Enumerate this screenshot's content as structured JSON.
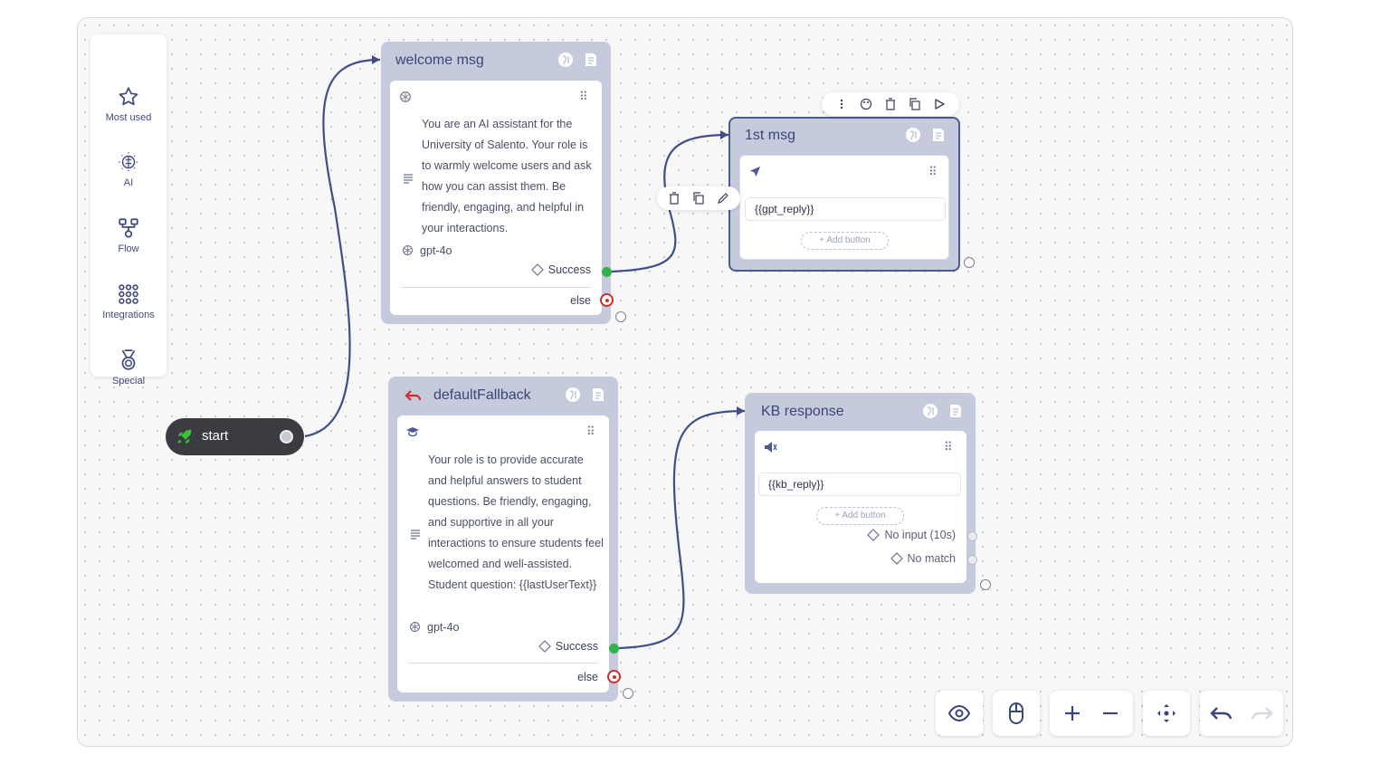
{
  "palette": {
    "items": [
      {
        "label": "Most used",
        "icon": "star-icon"
      },
      {
        "label": "AI",
        "icon": "brain-icon"
      },
      {
        "label": "Flow",
        "icon": "flow-icon"
      },
      {
        "label": "Integrations",
        "icon": "grid-icon"
      },
      {
        "label": "Special",
        "icon": "medal-icon"
      }
    ]
  },
  "start": {
    "label": "start"
  },
  "welcome": {
    "title": "welcome msg",
    "prompt": "You are an AI assistant for the University of Salento. Your role is to warmly welcome users and ask how you can assist them. Be friendly, engaging, and helpful in your interactions.",
    "model": "gpt-4o",
    "success": "Success",
    "else": "else"
  },
  "first": {
    "title": "1st msg",
    "field": "{{gpt_reply}}",
    "add_button": "+ Add button"
  },
  "fallback": {
    "title": "defaultFallback",
    "prompt": "Your role is to provide accurate and helpful answers to student questions. Be friendly, engaging, and supportive in all your interactions to ensure students feel welcomed and well-assisted. Student question: {{lastUserText}}",
    "model": "gpt-4o",
    "success": "Success",
    "else": "else"
  },
  "kb": {
    "title": "KB response",
    "field": "{{kb_reply}}",
    "add_button": "+ Add button",
    "no_input": "No input (10s)",
    "no_match": "No match"
  },
  "colors": {
    "node_bg": "#c5cadc",
    "wire": "#3f4f86",
    "success": "#32b24a",
    "else": "#d42c2c",
    "start_bg": "#3a3c42",
    "start_icon": "#3cc13b"
  }
}
